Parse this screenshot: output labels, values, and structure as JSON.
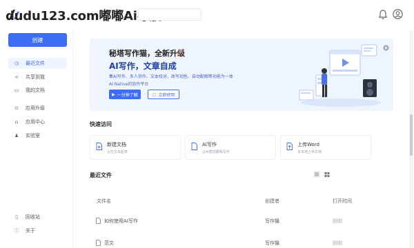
{
  "header": {
    "watermark": "dudu123.com嘟嘟Ai导航",
    "logo_text": "秘塔写作猫"
  },
  "sidebar": {
    "create_label": "创建",
    "items": [
      {
        "label": "最近文件",
        "icon": "clock-icon"
      },
      {
        "label": "共享到我",
        "icon": "share-icon"
      },
      {
        "label": "我的文档",
        "icon": "folder-icon"
      },
      {
        "label": "应用升级",
        "icon": "upgrade-icon"
      },
      {
        "label": "应用中心",
        "icon": "app-center-icon"
      },
      {
        "label": "实验室",
        "icon": "lab-icon"
      }
    ],
    "bottom_items": [
      {
        "label": "回收站",
        "icon": "trash-icon"
      },
      {
        "label": "关于",
        "icon": "info-icon"
      }
    ]
  },
  "hero": {
    "title": "秘塔写作猫，全新升级",
    "subtitle": "AI写作，文章自成",
    "desc": "集AI写作、多人协作、文本校对、改写润色、自动配图等功能为一体",
    "desc2": "AI Native的协作平台",
    "btn_primary": "一分钟了解",
    "btn_secondary": "立即使用"
  },
  "quick_access": {
    "title": "快速访问",
    "cards": [
      {
        "title": "新建文档",
        "desc": "从空文本起草",
        "icon": "new-doc-icon"
      },
      {
        "title": "AI写作",
        "desc": "让AI帮您跟我写作",
        "icon": "ai-doc-icon"
      },
      {
        "title": "上传Word",
        "desc": "多本地上传文档",
        "icon": "upload-icon"
      }
    ]
  },
  "recent": {
    "title": "最近文件",
    "columns": {
      "name": "文件名",
      "creator": "创建者",
      "time": "打开时间"
    },
    "rows": [
      {
        "name": "如何使用AI写作",
        "creator": "写作猫",
        "time": "刚刚"
      },
      {
        "name": "范文",
        "creator": "写作猫",
        "time": "刚刚"
      }
    ]
  },
  "colors": {
    "accent": "#3d6df2",
    "hero_bg": "#eef5ff"
  }
}
